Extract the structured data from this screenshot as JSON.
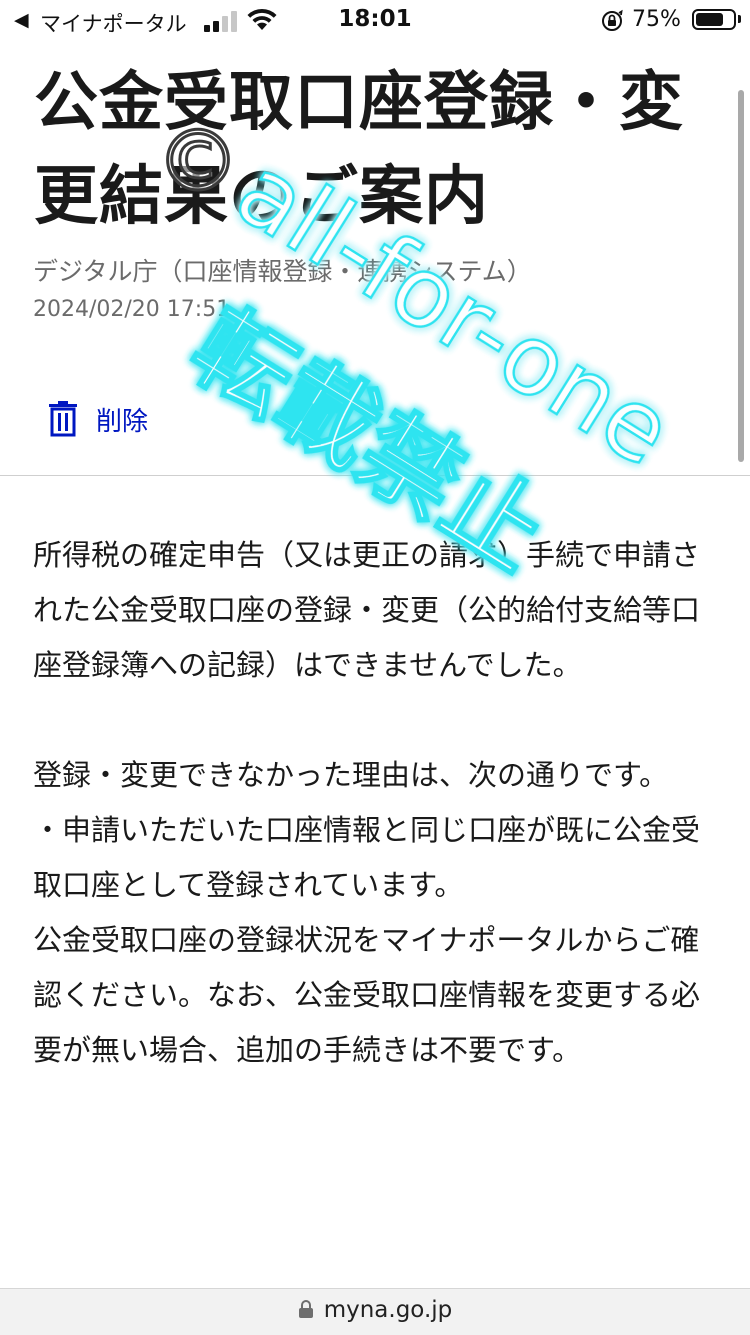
{
  "status_bar": {
    "back_arrow": "◀",
    "app_name": "マイナポータル",
    "time": "18:01",
    "battery_percent": "75%",
    "battery_level": 0.75
  },
  "header": {
    "title": "公金受取口座登録・変更結果のご案内",
    "sender": "デジタル庁（口座情報登録・連携システム）",
    "date": "2024/02/20 17:51"
  },
  "actions": {
    "delete_label": "削除"
  },
  "body": {
    "paragraph1": "所得税の確定申告（又は更正の請求）手続で申請された公金受取口座の登録・変更（公的給付支給等口座登録簿への記録）はできませんでした。",
    "paragraph2": "登録・変更できなかった理由は、次の通りです。",
    "paragraph3": "・申請いただいた口座情報と同じ口座が既に公金受取口座として登録されています。",
    "paragraph4": "公金受取口座の登録状況をマイナポータルからご確認ください。なお、公金受取口座情報を変更する必要が無い場合、追加の手続きは不要です。"
  },
  "watermark": {
    "text1": "all-for-one",
    "text2": "転載禁止",
    "symbol": "©"
  },
  "url_bar": {
    "url": "myna.go.jp"
  }
}
